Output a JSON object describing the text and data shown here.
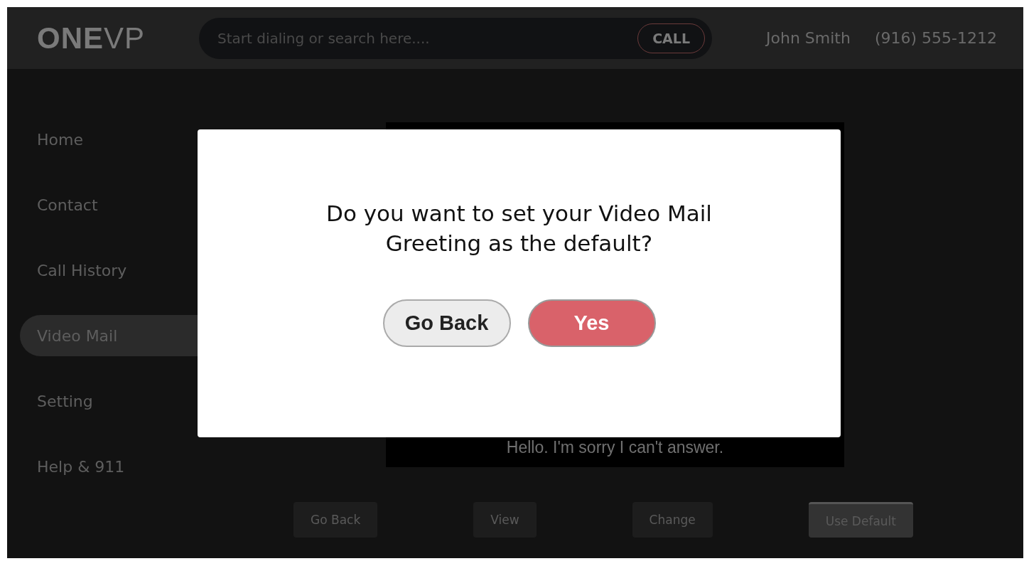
{
  "header": {
    "logo": "**ONE**VP",
    "search": {
      "placeholder": "Start dialing or search here...."
    },
    "call_button": "CALL",
    "user_name": "John Smith",
    "phone": "(916) 555-1212"
  },
  "sidebar": {
    "items": [
      {
        "label": "Home",
        "selected": false
      },
      {
        "label": "Contact",
        "selected": false
      },
      {
        "label": "Call History",
        "selected": false
      },
      {
        "label": "Video Mail",
        "selected": true
      },
      {
        "label": "Setting",
        "selected": false
      },
      {
        "label": "Help & 911",
        "selected": false
      }
    ]
  },
  "video": {
    "caption": "Hello. I'm sorry I can't answer."
  },
  "actions": [
    {
      "label": "Go Back",
      "selected": false
    },
    {
      "label": "View",
      "selected": false
    },
    {
      "label": "Change",
      "selected": false
    },
    {
      "label": "Use Default",
      "selected": true
    }
  ],
  "dialog": {
    "message": "Do you want to set your Video Mail Greeting as the default?",
    "buttons": [
      {
        "label": "Go Back",
        "kind": "secondary"
      },
      {
        "label": "Yes",
        "kind": "primary"
      }
    ]
  }
}
